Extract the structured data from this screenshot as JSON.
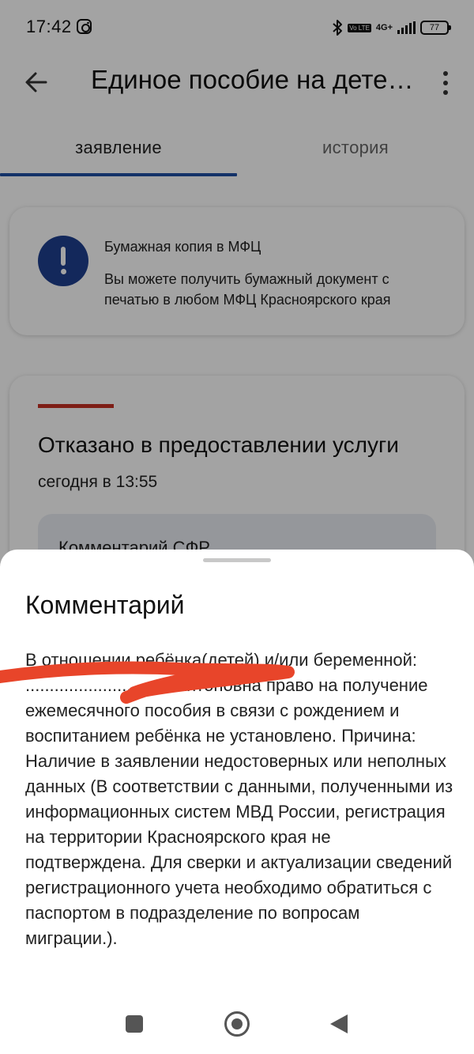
{
  "status_bar": {
    "time": "17:42",
    "network": "4G+",
    "volte": "Vo LTE",
    "battery": "77",
    "icons": [
      "instagram-icon",
      "bluetooth-icon",
      "volte-icon",
      "signal-icon",
      "battery-icon"
    ]
  },
  "header": {
    "title": "Единое пособие на детей и беременным",
    "icons": [
      "arrow-back-icon",
      "more-vert-icon"
    ]
  },
  "tabs": [
    {
      "label": "заявление",
      "active": true
    },
    {
      "label": "история",
      "active": false
    }
  ],
  "info_card": {
    "title": "Бумажная копия в МФЦ",
    "text": "Вы можете получить бумажный документ с печатью в любом МФЦ Красноярского края",
    "icon": "alert-icon"
  },
  "status_card": {
    "status": "Отказано в предоставлении услуги",
    "timestamp": "сегодня в 13:55",
    "comment_label": "Комментарий СФР"
  },
  "comment_sheet": {
    "title": "Комментарий",
    "body": "В отношении ребёнка(детей) и/или беременной: ...............................Антоновна право на получение ежемесячного пособия в связи с рождением и воспитанием ребёнка не установлено. Причина: Наличие в заявлении недостоверных или неполных данных (В соответствии с данными, полученными из информационных систем МВД России, регистрация на территории Красноярского края не подтверждена. Для сверки и актуализации сведений регистрационного учета необходимо обратиться с паспортом в подразделение по вопросам миграции.)."
  },
  "navbar": {
    "icons": [
      "recents-icon",
      "home-icon",
      "back-icon"
    ]
  },
  "colors": {
    "accent": "#1f4fa3",
    "alert_circle": "#1e3f8f",
    "status_rejected": "#c62f23",
    "redaction": "#e8452a"
  }
}
